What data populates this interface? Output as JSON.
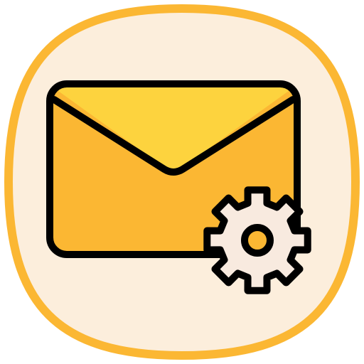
{
  "icon": {
    "name": "mail-settings-icon",
    "parts": [
      "rounded-square-background",
      "envelope-icon",
      "gear-icon"
    ]
  },
  "colors": {
    "background_fill": "#FCEEDC",
    "background_border": "#FBB733",
    "envelope_body": "#FBB733",
    "envelope_flap": "#FDD33E",
    "gear_fill": "#F8EADF",
    "outline": "#000000"
  }
}
